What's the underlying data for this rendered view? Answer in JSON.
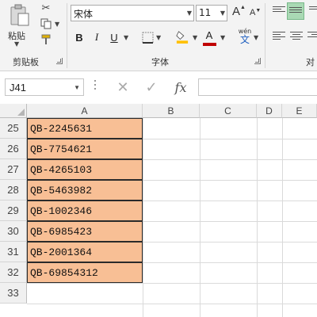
{
  "ribbon": {
    "clipboard": {
      "paste_label": "粘贴",
      "group_label": "剪贴板"
    },
    "font": {
      "font_name": "宋体",
      "font_size": "11",
      "grow_label": "A",
      "shrink_label": "A",
      "bold": "B",
      "italic": "I",
      "underline": "U",
      "phonetic": "wén",
      "phonetic_char": "文",
      "font_color_char": "A",
      "font_color": "#c00000",
      "fill_color": "#ffc000",
      "group_label": "字体"
    },
    "alignment": {
      "group_label_partial": "对"
    }
  },
  "formula_bar": {
    "name_box": "J41",
    "cancel_glyph": "✕",
    "enter_glyph": "✓",
    "fx_label": "fx",
    "formula": ""
  },
  "grid": {
    "columns": [
      "A",
      "B",
      "C",
      "D",
      "E"
    ],
    "rows": [
      "25",
      "26",
      "27",
      "28",
      "29",
      "30",
      "31",
      "32",
      "33"
    ],
    "cells_A": [
      "QB-2245631",
      "QB-7754621",
      "QB-4265103",
      "QB-5463982",
      "QB-1002346",
      "QB-6985423",
      "QB-2001364",
      "QB-69854312"
    ],
    "cell_fill": "#f8bf95"
  }
}
